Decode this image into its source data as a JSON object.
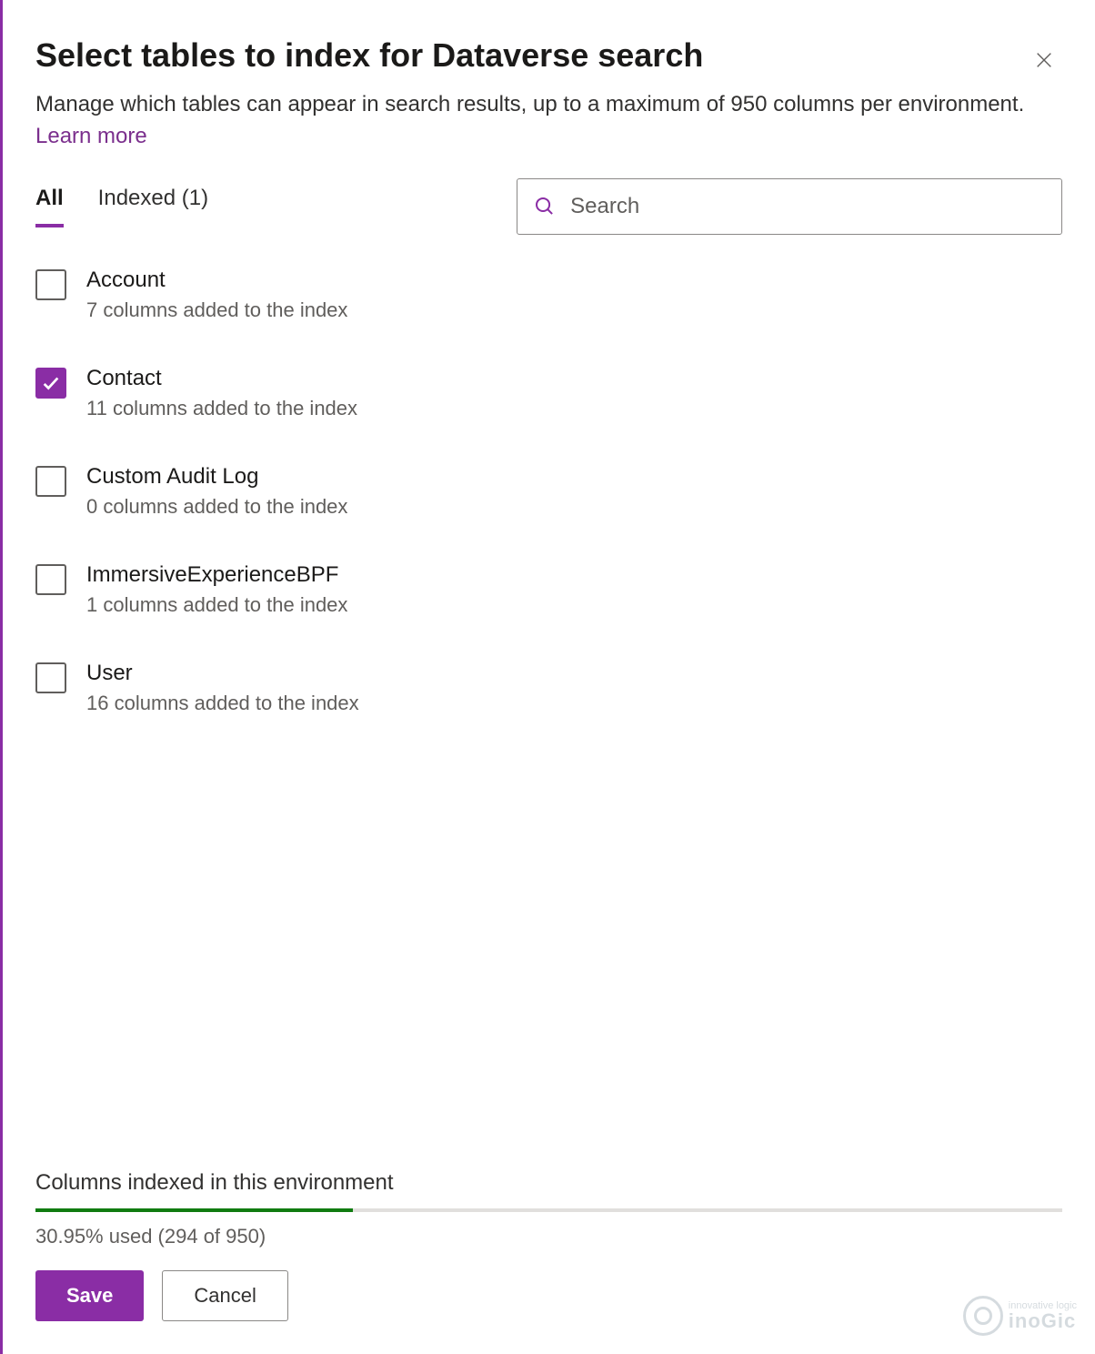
{
  "header": {
    "title": "Select tables to index for Dataverse search",
    "subtitle": "Manage which tables can appear in search results, up to a maximum of 950 columns per environment. ",
    "learn_more": "Learn more"
  },
  "tabs": {
    "all": "All",
    "indexed": "Indexed (1)"
  },
  "search": {
    "placeholder": "Search"
  },
  "tables": [
    {
      "name": "Account",
      "desc": "7 columns added to the index",
      "checked": false
    },
    {
      "name": "Contact",
      "desc": "11 columns added to the index",
      "checked": true
    },
    {
      "name": "Custom Audit Log",
      "desc": "0 columns added to the index",
      "checked": false
    },
    {
      "name": "ImmersiveExperienceBPF",
      "desc": "1 columns added to the index",
      "checked": false
    },
    {
      "name": "User",
      "desc": "16 columns added to the index",
      "checked": false
    }
  ],
  "progress": {
    "label": "Columns indexed in this environment",
    "text": "30.95% used (294 of 950)",
    "percent": 30.95
  },
  "buttons": {
    "save": "Save",
    "cancel": "Cancel"
  },
  "watermark": {
    "small": "innovative logic",
    "big": "inoGic"
  }
}
